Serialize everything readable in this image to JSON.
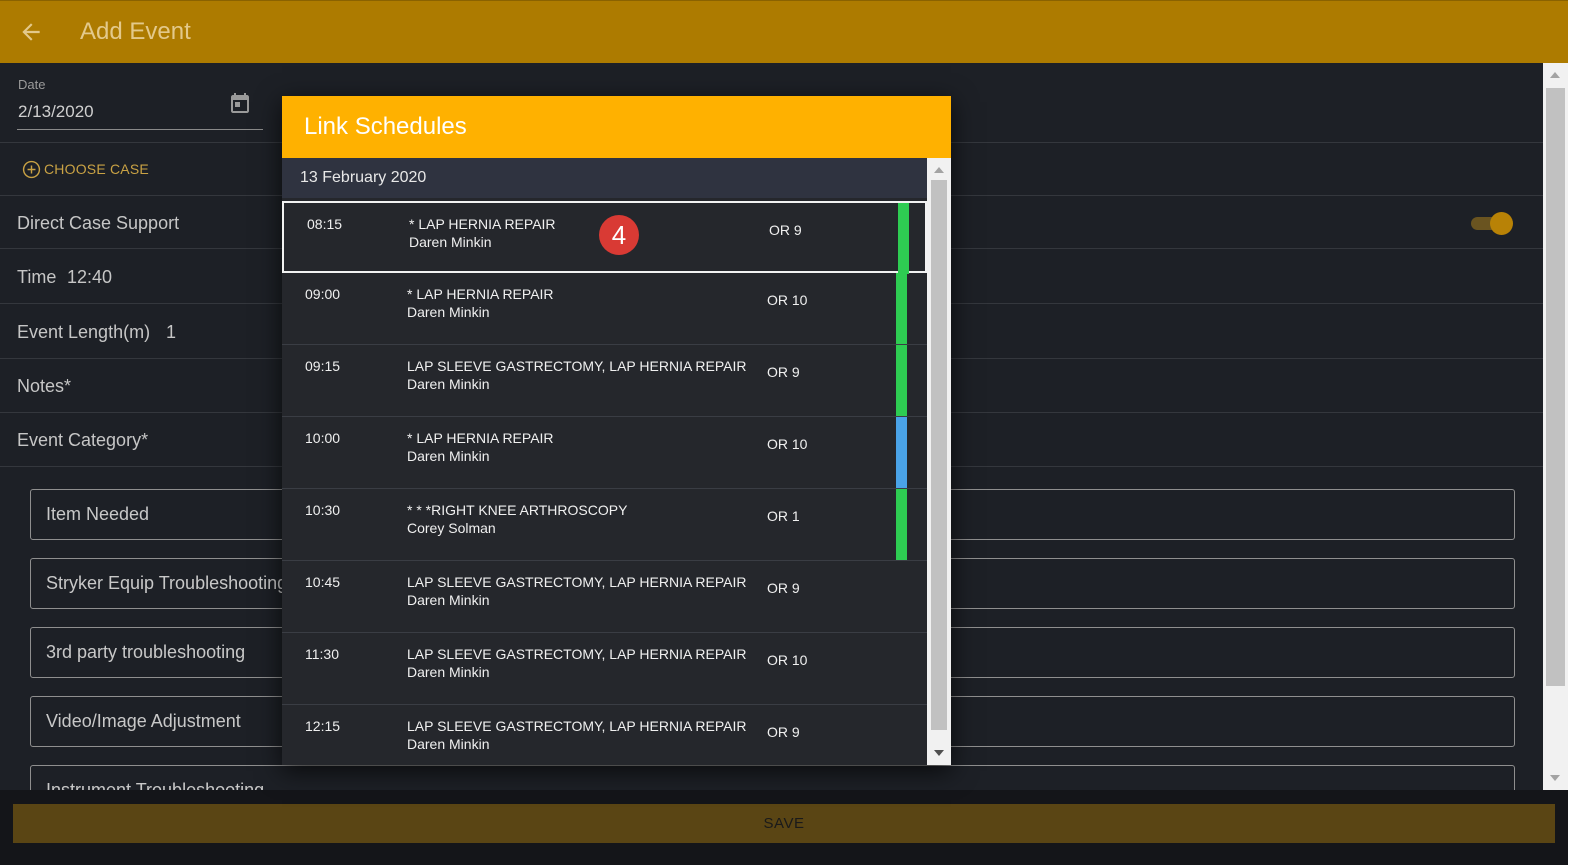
{
  "appbar": {
    "title": "Add Event",
    "back_icon": "arrow-left-icon",
    "color": "#ad7b00"
  },
  "form": {
    "date_label": "Date",
    "date_value": "2/13/2020",
    "calendar_icon": "calendar-icon",
    "choose_case_label": "CHOOSE CASE",
    "direct_case_support_label": "Direct Case Support",
    "direct_case_support_on": true,
    "time_label": "Time",
    "time_value": "12:40",
    "event_length_label": "Event Length(m)",
    "event_length_value": "1",
    "notes_label": "Notes*",
    "event_category_label": "Event Category*",
    "categories": [
      "Item Needed",
      "Stryker Equip Troubleshooting",
      "3rd party troubleshooting",
      "Video/Image Adjustment",
      "Instrument Troubleshooting"
    ],
    "save_label": "SAVE"
  },
  "dialog": {
    "title": "Link Schedules",
    "header_color": "#ffb100",
    "date_header": "13 February 2020",
    "rows": [
      {
        "time": "08:15",
        "procedure": "* LAP HERNIA REPAIR",
        "doctor": "Daren Minkin",
        "room": "OR 9",
        "status_color": "#2ecc52",
        "selected": true,
        "badge": "4"
      },
      {
        "time": "09:00",
        "procedure": "* LAP HERNIA REPAIR",
        "doctor": "Daren Minkin",
        "room": "OR 10",
        "status_color": "#2ecc52"
      },
      {
        "time": "09:15",
        "procedure": "LAP SLEEVE GASTRECTOMY, LAP HERNIA REPAIR",
        "doctor": "Daren Minkin",
        "room": "OR 9",
        "status_color": "#2ecc52"
      },
      {
        "time": "10:00",
        "procedure": "* LAP HERNIA REPAIR",
        "doctor": "Daren Minkin",
        "room": "OR 10",
        "status_color": "#4aa3e8"
      },
      {
        "time": "10:30",
        "procedure": "* * *RIGHT KNEE ARTHROSCOPY",
        "doctor": "Corey Solman",
        "room": "OR 1",
        "status_color": "#2ecc52"
      },
      {
        "time": "10:45",
        "procedure": "LAP SLEEVE GASTRECTOMY, LAP HERNIA REPAIR",
        "doctor": "Daren Minkin",
        "room": "OR 9",
        "status_color": ""
      },
      {
        "time": "11:30",
        "procedure": "LAP SLEEVE GASTRECTOMY, LAP HERNIA REPAIR",
        "doctor": "Daren Minkin",
        "room": "OR 10",
        "status_color": ""
      },
      {
        "time": "12:15",
        "procedure": "LAP SLEEVE GASTRECTOMY, LAP HERNIA REPAIR",
        "doctor": "Daren Minkin",
        "room": "OR 9",
        "status_color": ""
      }
    ]
  }
}
